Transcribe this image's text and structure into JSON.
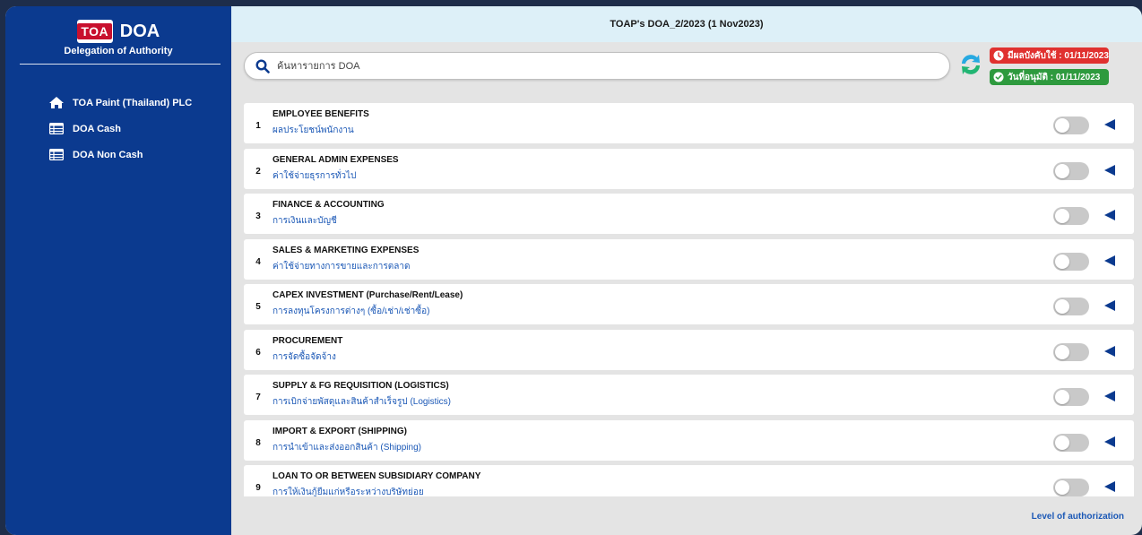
{
  "sidebar": {
    "logo_text": "TOA",
    "brand_name": "DOA",
    "brand_subtitle": "Delegation of Authority",
    "items": [
      {
        "label": "TOA Paint (Thailand) PLC",
        "icon": "home-icon"
      },
      {
        "label": "DOA Cash",
        "icon": "table-icon"
      },
      {
        "label": "DOA Non Cash",
        "icon": "table-icon"
      }
    ]
  },
  "header": {
    "title": "TOAP's DOA_2/2023 (1 Nov2023)"
  },
  "search": {
    "placeholder": "ค้นหารายการ DOA"
  },
  "badges": {
    "effective": "มีผลบังคับใช้ : 01/11/2023",
    "approved": "วันที่อนุมัติ : 01/11/2023"
  },
  "categories": [
    {
      "num": "1",
      "en": "EMPLOYEE BENEFITS",
      "th": "ผลประโยชน์พนักงาน"
    },
    {
      "num": "2",
      "en": "GENERAL ADMIN EXPENSES",
      "th": "ค่าใช้จ่ายธุรการทั่วไป"
    },
    {
      "num": "3",
      "en": "FINANCE & ACCOUNTING",
      "th": "การเงินและบัญชี"
    },
    {
      "num": "4",
      "en": "SALES & MARKETING EXPENSES",
      "th": "ค่าใช้จ่ายทางการขายและการตลาด"
    },
    {
      "num": "5",
      "en": "CAPEX INVESTMENT (Purchase/Rent/Lease)",
      "th": "การลงทุนโครงการต่างๆ (ซื้อ/เช่า/เช่าซื้อ)"
    },
    {
      "num": "6",
      "en": "PROCUREMENT",
      "th": "การจัดซื้อจัดจ้าง"
    },
    {
      "num": "7",
      "en": "SUPPLY & FG REQUISITION (LOGISTICS)",
      "th": "การเบิกจ่ายพัสดุและสินค้าสำเร็จรูป (Logistics)"
    },
    {
      "num": "8",
      "en": "IMPORT & EXPORT (SHIPPING)",
      "th": "การนำเข้าและส่งออกสินค้า (Shipping)"
    },
    {
      "num": "9",
      "en": "LOAN TO OR BETWEEN SUBSIDIARY COMPANY",
      "th": "การให้เงินกู้ยืมแก่หรือระหว่างบริษัทย่อย"
    }
  ],
  "footer": {
    "link": "Level of authorization"
  },
  "colors": {
    "sidebar": "#0b3a8f",
    "accent_blue": "#1b58b6",
    "badge_red": "#e0312f",
    "badge_green": "#2e9a3e",
    "refresh_green": "#22b573",
    "refresh_blue": "#27a9e1"
  }
}
